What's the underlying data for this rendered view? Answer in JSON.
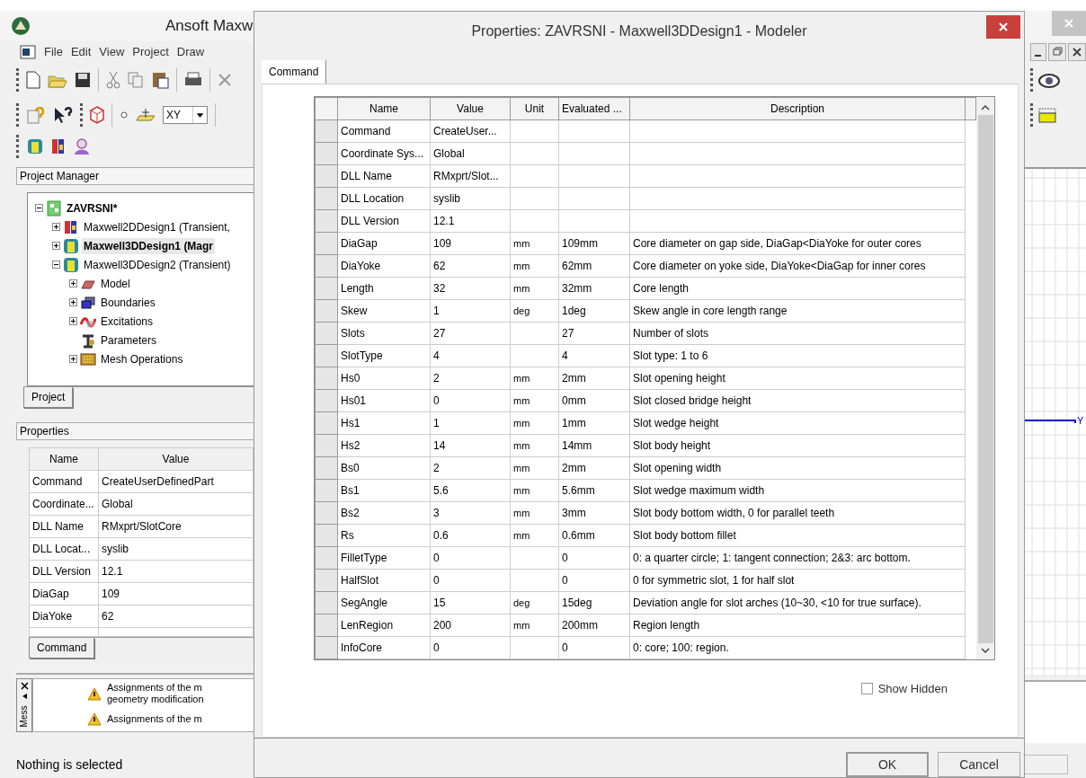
{
  "main_window": {
    "title": "Ansoft Maxw",
    "menu": [
      "File",
      "Edit",
      "View",
      "Project",
      "Draw"
    ],
    "plane_select": "XY",
    "project_manager": {
      "title": "Project Manager",
      "tab": "Project",
      "tree": [
        {
          "label": "ZAVRSNI*",
          "kind": "project",
          "expanded": true,
          "selected": false,
          "children": [
            {
              "label": "Maxwell2DDesign1 (Transient,",
              "kind": "design2d",
              "expanded": false,
              "selected": false
            },
            {
              "label": "Maxwell3DDesign1 (Magr",
              "kind": "design3d",
              "expanded": false,
              "selected": true
            },
            {
              "label": "Maxwell3DDesign2 (Transient)",
              "kind": "design3d",
              "expanded": true,
              "selected": false,
              "children": [
                {
                  "label": "Model",
                  "kind": "model",
                  "expanded": false,
                  "selected": false
                },
                {
                  "label": "Boundaries",
                  "kind": "boundaries",
                  "expanded": false,
                  "selected": false
                },
                {
                  "label": "Excitations",
                  "kind": "excitations",
                  "expanded": false,
                  "selected": false
                },
                {
                  "label": "Parameters",
                  "kind": "parameters",
                  "selected": false
                },
                {
                  "label": "Mesh Operations",
                  "kind": "mesh",
                  "expanded": false,
                  "selected": false
                }
              ]
            }
          ]
        }
      ]
    },
    "properties": {
      "title": "Properties",
      "tab": "Command",
      "columns": [
        "Name",
        "Value"
      ],
      "rows": [
        [
          "Command",
          "CreateUserDefinedPart"
        ],
        [
          "Coordinate...",
          "Global"
        ],
        [
          "DLL Name",
          "RMxprt/SlotCore"
        ],
        [
          "DLL Locat...",
          "syslib"
        ],
        [
          "DLL Version",
          "12.1"
        ],
        [
          "DiaGap",
          "109"
        ],
        [
          "DiaYoke",
          "62"
        ]
      ]
    },
    "messages": {
      "tab": "Mess",
      "items": [
        {
          "lines": [
            "Assignments of the m",
            "geometry modification"
          ]
        },
        {
          "lines": [
            "Assignments of the m"
          ]
        }
      ]
    },
    "canvas": {
      "axis_label": "Y"
    },
    "status_bar": "Nothing is selected"
  },
  "dialog": {
    "title": "Properties: ZAVRSNI - Maxwell3DDesign1 - Modeler",
    "tabs": [
      {
        "label": "Command",
        "selected": true
      }
    ],
    "table": {
      "columns": [
        "Name",
        "Value",
        "Unit",
        "Evaluated ...",
        "Description"
      ],
      "rows": [
        [
          "Command",
          "CreateUser...",
          "",
          "",
          ""
        ],
        [
          "Coordinate Sys...",
          "Global",
          "",
          "",
          ""
        ],
        [
          "DLL Name",
          "RMxprt/Slot...",
          "",
          "",
          ""
        ],
        [
          "DLL Location",
          "syslib",
          "",
          "",
          ""
        ],
        [
          "DLL Version",
          "12.1",
          "",
          "",
          ""
        ],
        [
          "DiaGap",
          "109",
          "mm",
          "109mm",
          "Core diameter on gap side, DiaGap<DiaYoke for outer cores"
        ],
        [
          "DiaYoke",
          "62",
          "mm",
          "62mm",
          "Core diameter on yoke side, DiaYoke<DiaGap for inner cores"
        ],
        [
          "Length",
          "32",
          "mm",
          "32mm",
          "Core length"
        ],
        [
          "Skew",
          "1",
          "deg",
          "1deg",
          "Skew angle in core length range"
        ],
        [
          "Slots",
          "27",
          "",
          "27",
          "Number of slots"
        ],
        [
          "SlotType",
          "4",
          "",
          "4",
          "Slot type: 1 to 6"
        ],
        [
          "Hs0",
          "2",
          "mm",
          "2mm",
          "Slot opening height"
        ],
        [
          "Hs01",
          "0",
          "mm",
          "0mm",
          "Slot closed bridge height"
        ],
        [
          "Hs1",
          "1",
          "mm",
          "1mm",
          "Slot wedge height"
        ],
        [
          "Hs2",
          "14",
          "mm",
          "14mm",
          "Slot body height"
        ],
        [
          "Bs0",
          "2",
          "mm",
          "2mm",
          "Slot opening width"
        ],
        [
          "Bs1",
          "5.6",
          "mm",
          "5.6mm",
          "Slot wedge maximum width"
        ],
        [
          "Bs2",
          "3",
          "mm",
          "3mm",
          "Slot body bottom width, 0 for parallel teeth"
        ],
        [
          "Rs",
          "0.6",
          "mm",
          "0.6mm",
          "Slot body bottom fillet"
        ],
        [
          "FilletType",
          "0",
          "",
          "0",
          "0: a quarter circle; 1: tangent connection; 2&3: arc bottom."
        ],
        [
          "HalfSlot",
          "0",
          "",
          "0",
          "0 for symmetric slot, 1 for half slot"
        ],
        [
          "SegAngle",
          "15",
          "deg",
          "15deg",
          "Deviation angle for slot arches (10~30, <10 for true surface)."
        ],
        [
          "LenRegion",
          "200",
          "mm",
          "200mm",
          "Region length"
        ],
        [
          "InfoCore",
          "0",
          "",
          "0",
          "0: core; 100: region."
        ]
      ]
    },
    "show_hidden": {
      "label": "Show Hidden",
      "checked": false
    },
    "buttons": [
      "OK",
      "Cancel"
    ]
  }
}
